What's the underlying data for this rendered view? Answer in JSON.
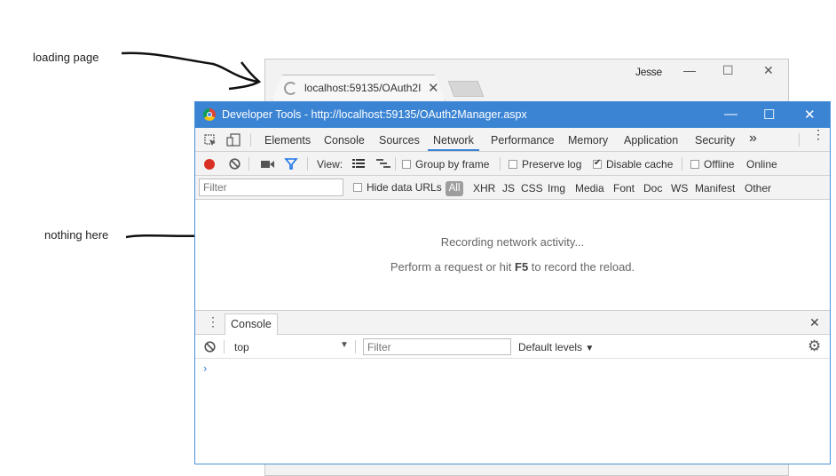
{
  "annotations": {
    "loading_label": "loading page",
    "nothing_label": "nothing here"
  },
  "browser": {
    "tab_title": "localhost:59135/OAuth2I",
    "user_name": "Jesse"
  },
  "devtools": {
    "title": "Developer Tools - http://localhost:59135/OAuth2Manager.aspx",
    "tabs": [
      "Elements",
      "Console",
      "Sources",
      "Network",
      "Performance",
      "Memory",
      "Application",
      "Security"
    ],
    "active_tab": "Network",
    "more_tabs": "»",
    "toolbar": {
      "view_label": "View:",
      "group_by_frame": "Group by frame",
      "preserve_log": "Preserve log",
      "disable_cache": "Disable cache",
      "offline": "Offline",
      "online": "Online",
      "disable_cache_checked": true
    },
    "filter": {
      "placeholder": "Filter",
      "hide_data_urls": "Hide data URLs",
      "types": [
        "All",
        "XHR",
        "JS",
        "CSS",
        "Img",
        "Media",
        "Font",
        "Doc",
        "WS",
        "Manifest",
        "Other"
      ]
    },
    "empty": {
      "line1": "Recording network activity...",
      "line2_pre": "Perform a request or hit ",
      "line2_key": "F5",
      "line2_post": " to record the reload."
    },
    "drawer": {
      "tab": "Console",
      "context": "top",
      "filter_placeholder": "Filter",
      "levels": "Default levels",
      "prompt": "›"
    }
  },
  "colors": {
    "title_bar": "#3b84d4",
    "record_red": "#d93025",
    "filter_blue": "#1a73e8"
  }
}
